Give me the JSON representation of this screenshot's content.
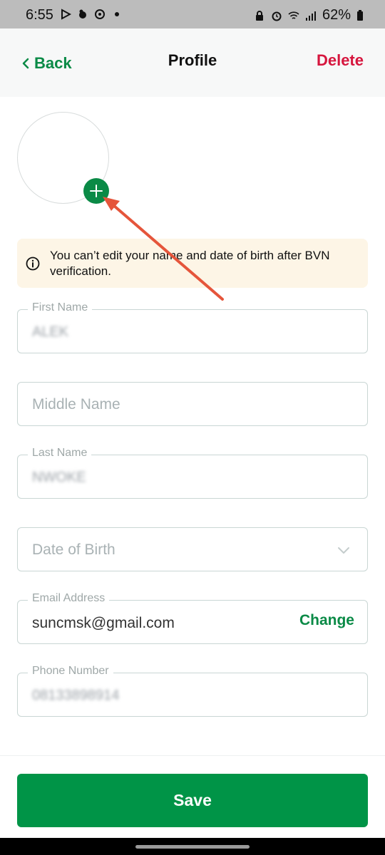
{
  "status_bar": {
    "time": "6:55",
    "battery": "62%",
    "left_icons": [
      "play-icon",
      "bird-icon",
      "sync-icon",
      "dot-icon"
    ],
    "right_icons": [
      "lock-icon",
      "alarm-icon",
      "wifi-icon",
      "signal-icon",
      "battery-icon"
    ]
  },
  "header": {
    "back_label": "Back",
    "title": "Profile",
    "delete_label": "Delete"
  },
  "notice": {
    "text": "You can’t edit your name and date of birth after BVN verification."
  },
  "fields": {
    "first_name": {
      "label": "First Name",
      "value": "ALEK"
    },
    "middle_name": {
      "placeholder": "Middle Name"
    },
    "last_name": {
      "label": "Last Name",
      "value": "NWOKE"
    },
    "date_of_birth": {
      "placeholder": "Date of Birth"
    },
    "email": {
      "label": "Email Address",
      "value": "suncmsk@gmail.com",
      "action": "Change"
    },
    "phone": {
      "label": "Phone Number",
      "value": "08133898914"
    }
  },
  "save_label": "Save",
  "colors": {
    "accent_green": "#0a8a46",
    "button_green": "#009447",
    "delete_red": "#d6163e",
    "notice_bg": "#fdf5e6",
    "annotation_arrow": "#e5553b"
  }
}
